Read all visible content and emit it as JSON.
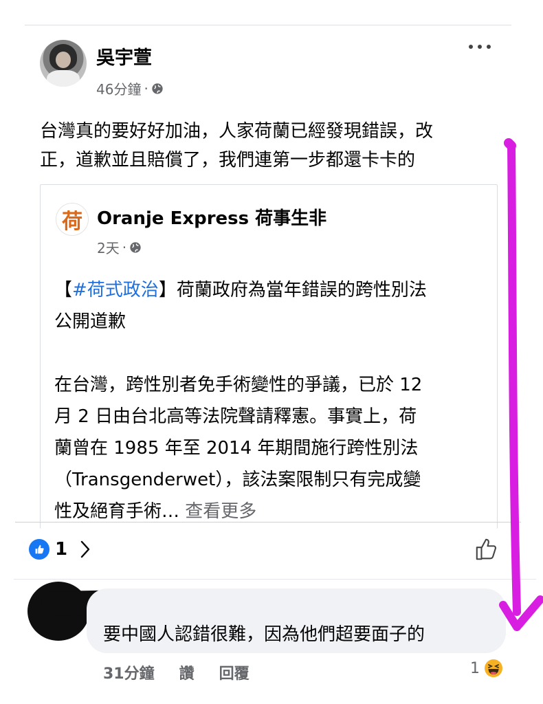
{
  "post": {
    "author": "吳宇萱",
    "time": "46分鐘",
    "separator": "·",
    "globe_icon": "globe-icon",
    "more_icon": "more-options-icon",
    "text_lines": [
      "台灣真的要好好加油，人家荷蘭已經發現錯誤，改",
      "正，道歉並且賠償了，我們連第一步都還卡卡的"
    ]
  },
  "shared": {
    "page_logo": "荷",
    "page_name": "Oranje Express 荷事生非",
    "time": "2天",
    "separator": "·",
    "line1_open": "【",
    "hashtag": "#荷式政治",
    "line1_rest": "】荷蘭政府為當年錯誤的跨性別法",
    "line2": "公開道歉",
    "body_lines": [
      "在台灣，跨性別者免手術變性的爭議，已於 12",
      "月 2 日由台北高等法院聲請釋憲。事實上，荷",
      "蘭曾在 1985 年至 2014 年期間施行跨性別法",
      "（Transgenderwet），該法案限制只有完成變"
    ],
    "last_line": "性及絕育手術…",
    "see_more": "查看更多"
  },
  "reactions": {
    "count": "1",
    "like_icon": "like-badge-icon",
    "chevron": "chevron-right-icon",
    "thumbs_up": "thumbs-up-icon"
  },
  "comment": {
    "text": "要中國人認錯很難，因為他們超要面子的",
    "time": "31分鐘",
    "like_label": "讚",
    "reply_label": "回覆",
    "reaction_count": "1",
    "reaction_icon": "haha-emoji-icon"
  },
  "colors": {
    "annotation": "#d81ee0",
    "link": "#216fdb",
    "like": "#1877f2",
    "meta": "#65676b"
  }
}
